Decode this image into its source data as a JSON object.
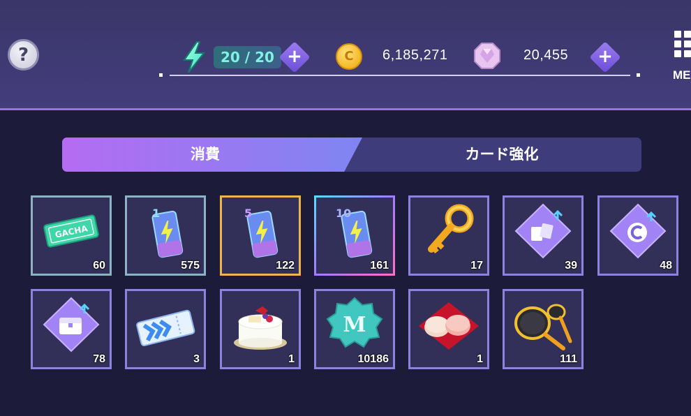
{
  "header": {
    "help_label": "?",
    "energy": "20 / 20",
    "coins": "6,185,271",
    "gems": "20,455",
    "plus_symbol": "+",
    "coin_letter": "C",
    "menu_label": "ME"
  },
  "tabs": [
    {
      "label": "消費",
      "active": true
    },
    {
      "label": "カード強化",
      "active": false
    }
  ],
  "items": [
    {
      "name": "gacha-ticket",
      "count": "60",
      "label": "GACHA"
    },
    {
      "name": "energy-drink-1",
      "count": "575",
      "label": "1"
    },
    {
      "name": "energy-drink-5",
      "count": "122",
      "label": "5"
    },
    {
      "name": "energy-drink-10",
      "count": "161",
      "label": "10"
    },
    {
      "name": "gold-key",
      "count": "17"
    },
    {
      "name": "card-upgrade-item",
      "count": "39"
    },
    {
      "name": "coin-upgrade-item",
      "count": "48"
    },
    {
      "name": "chest-upgrade-item",
      "count": "78"
    },
    {
      "name": "skip-ticket",
      "count": "3"
    },
    {
      "name": "birthday-cake",
      "count": "1"
    },
    {
      "name": "m-medal",
      "count": "10186",
      "label": "M"
    },
    {
      "name": "macarons",
      "count": "1"
    },
    {
      "name": "frying-pan",
      "count": "111"
    }
  ],
  "colors": {
    "background": "#1d1b3a",
    "header": "#433d7c",
    "accent": "#9a72e8",
    "energy_text": "#7ff2e2",
    "coin": "#f2b21a"
  }
}
